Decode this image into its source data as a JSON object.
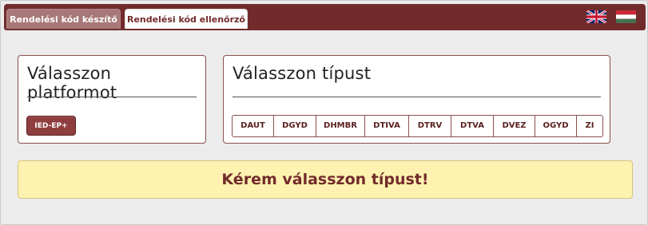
{
  "header": {
    "tabs": [
      {
        "label": "Rendelési kód készítő",
        "active": true
      },
      {
        "label": "Rendelési kód ellenőrző",
        "active": false
      }
    ],
    "flags": [
      {
        "icon": "uk-flag-icon",
        "language": "en"
      },
      {
        "icon": "hungary-flag-icon",
        "language": "hu"
      }
    ]
  },
  "platform_panel": {
    "title": "Válasszon platformot",
    "button_label": "IED-EP+"
  },
  "type_panel": {
    "title": "Válasszon típust",
    "types": [
      "DAUT",
      "DGYD",
      "DHMBR",
      "DTIVA",
      "DTRV",
      "DTVA",
      "DVEZ",
      "OGYD",
      "ZI"
    ]
  },
  "notice": {
    "text": "Kérem válasszon típust!"
  },
  "colors": {
    "brand": "#722b2b",
    "notice_bg": "#fff2b0",
    "page_bg": "#ececec"
  }
}
